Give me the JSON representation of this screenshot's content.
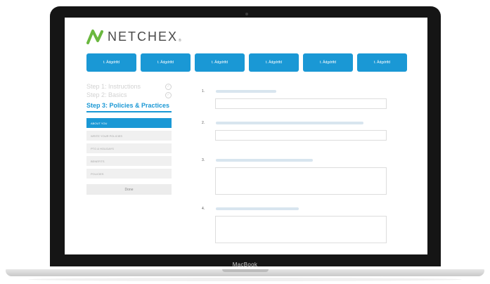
{
  "device": {
    "label": "MacBook"
  },
  "brand": {
    "name": "Netchex",
    "name_display": "NETCHEX",
    "registered": "®",
    "logo_color": "#6ab83f"
  },
  "nav_buttons": [
    {
      "label": "t. Ädgdrtfd"
    },
    {
      "label": "t. Ädgdrtfd"
    },
    {
      "label": "t. Ädgdrtfd"
    },
    {
      "label": "t. Ädgdrtfd"
    },
    {
      "label": "t. Ädgdrtfd"
    },
    {
      "label": "t. Ädgdrtfd"
    }
  ],
  "steps": {
    "step1": "Step 1: Instructions",
    "step2": "Step 2: Basics",
    "current": "Step 3: Policies & Practices"
  },
  "menu": [
    {
      "label": "ABOUT YOU"
    },
    {
      "label": "WRITE YOUR POLICIES"
    },
    {
      "label": "PTO & HOLIDAYS"
    },
    {
      "label": "BENEFITS"
    },
    {
      "label": "POLICIES"
    }
  ],
  "done_label": "Done",
  "questions": [
    {
      "num": "1."
    },
    {
      "num": "2."
    },
    {
      "num": "3."
    },
    {
      "num": "4."
    }
  ],
  "colors": {
    "accent": "#1a98d5",
    "bezel": "#151515"
  }
}
